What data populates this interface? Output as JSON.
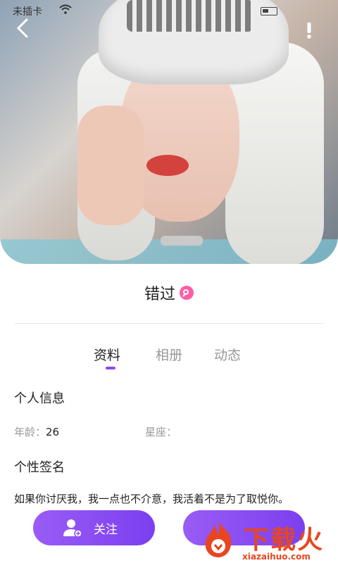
{
  "status": {
    "carrier": "未插卡"
  },
  "profile": {
    "name": "错过"
  },
  "tabs": [
    "资料",
    "相册",
    "动态"
  ],
  "info": {
    "section_title": "个人信息",
    "age_label": "年龄：",
    "age_value": "26",
    "constellation_label": "星座："
  },
  "signature": {
    "section_title": "个性签名",
    "text": "如果你讨厌我，我一点也不介意，我活着不是为了取悦你。"
  },
  "actions": {
    "follow_label": "关注"
  },
  "watermark": {
    "title": "下载火",
    "url": "xiazaihuo.com"
  },
  "colors": {
    "accent": "#8b4bf2",
    "gender": "#ff5ca8",
    "watermark": "#e8461f"
  },
  "icons": [
    "back-arrow-icon",
    "more-icon",
    "wifi-icon",
    "battery-icon",
    "female-gender-icon",
    "user-add-icon"
  ]
}
